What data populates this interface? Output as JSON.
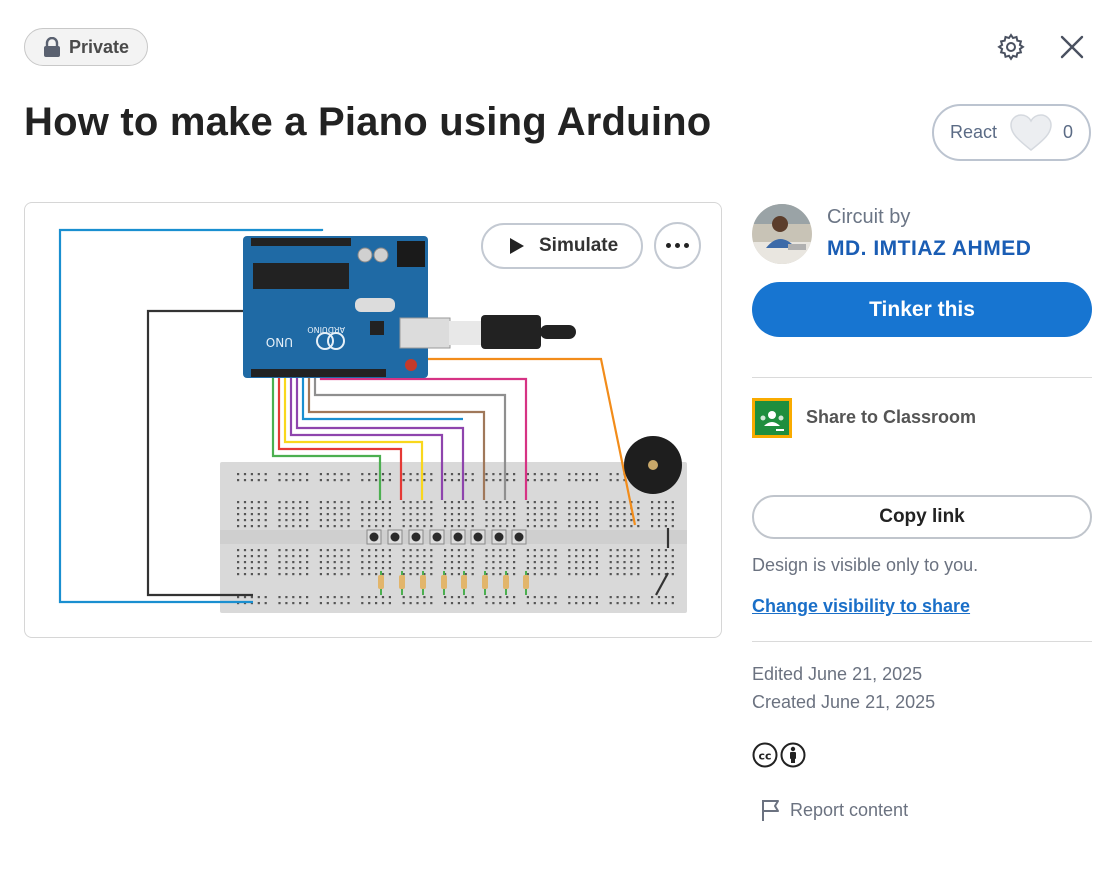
{
  "header": {
    "privacy_label": "Private",
    "settings_icon": "gear-icon",
    "close_icon": "close-icon"
  },
  "title": "How to make a Piano using Arduino",
  "react": {
    "label": "React",
    "count": "0"
  },
  "canvas": {
    "simulate_label": "Simulate",
    "more_icon": "more-dots-icon",
    "board_label": "ARDUINO",
    "board_model": "UNO"
  },
  "author": {
    "prefix": "Circuit by",
    "name": "MD. IMTIAZ AHMED"
  },
  "actions": {
    "tinker_label": "Tinker this",
    "share_classroom_label": "Share to Classroom",
    "copy_link_label": "Copy link",
    "visibility_note": "Design is visible only to you.",
    "change_visibility_label": "Change visibility to share"
  },
  "meta": {
    "edited": "Edited June 21, 2025",
    "created": "Created June 21, 2025",
    "license_icons": [
      "cc-icon",
      "attribution-icon"
    ],
    "report_label": "Report content"
  },
  "colors": {
    "accent": "#1775d1",
    "author": "#1a5db4",
    "board": "#1f6aa5",
    "classroom_green": "#1e8e3e",
    "classroom_yellow": "#f9ab00"
  }
}
